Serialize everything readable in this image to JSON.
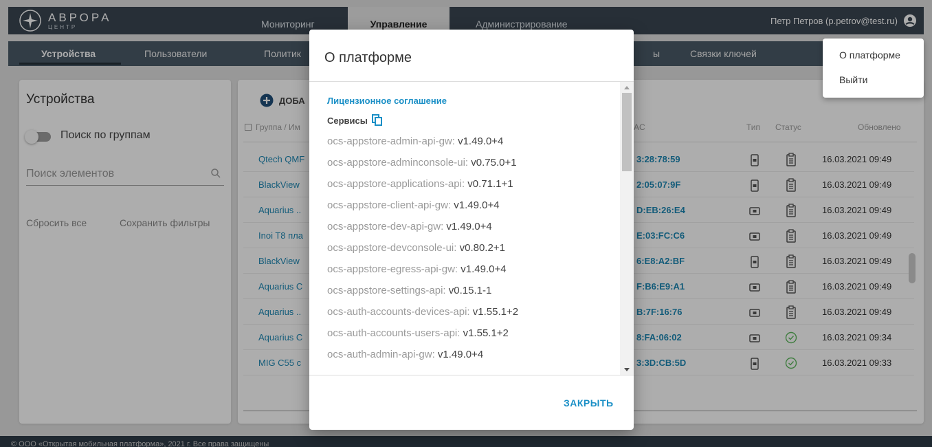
{
  "app": {
    "logo_title": "АВРОРА",
    "logo_subtitle": "ЦЕНТР",
    "nav_tabs": [
      {
        "label": "Мониторинг"
      },
      {
        "label": "Управление"
      },
      {
        "label": "Администрирование"
      }
    ],
    "user": "Петр Петров (p.petrov@test.ru)",
    "user_icon": "account-circle-icon"
  },
  "subnav": {
    "items": [
      {
        "label": "Устройства"
      },
      {
        "label": "Пользователи"
      },
      {
        "label": "Политик"
      },
      {
        "label": "ы"
      },
      {
        "label": "Связки ключей"
      }
    ]
  },
  "filters": {
    "title": "Устройства",
    "group_search_toggle": "Поиск по группам",
    "search_placeholder": "Поиск элементов",
    "reset": "Сбросить все",
    "save": "Сохранить фильтры"
  },
  "devices": {
    "add_label": "ДОБА",
    "columns": {
      "group": "Группа / Им",
      "mac": "AC",
      "type": "Тип",
      "status": "Статус",
      "updated": "Обновлено"
    },
    "rows": [
      {
        "name": "Qtech QMF",
        "mac": "3:28:78:59",
        "type_icon": "phone-icon",
        "status_icon": "clipboard-icon",
        "updated": "16.03.2021 09:49"
      },
      {
        "name": "BlackView",
        "mac": "2:05:07:9F",
        "type_icon": "phone-icon",
        "status_icon": "clipboard-icon",
        "updated": "16.03.2021 09:49"
      },
      {
        "name": "Aquarius ..",
        "mac": "D:EB:26:E4",
        "type_icon": "tablet-icon",
        "status_icon": "clipboard-icon",
        "updated": "16.03.2021 09:49"
      },
      {
        "name": "Inoi T8 пла",
        "mac": "E:03:FC:C6",
        "type_icon": "tablet-icon",
        "status_icon": "clipboard-icon",
        "updated": "16.03.2021 09:49"
      },
      {
        "name": "BlackView",
        "mac": "6:E8:A2:BF",
        "type_icon": "phone-icon",
        "status_icon": "clipboard-icon",
        "updated": "16.03.2021 09:49"
      },
      {
        "name": "Aquarius C",
        "mac": "F:B6:E9:A1",
        "type_icon": "tablet-icon",
        "status_icon": "clipboard-icon",
        "updated": "16.03.2021 09:49"
      },
      {
        "name": "Aquarius ..",
        "mac": "B:7F:16:76",
        "type_icon": "tablet-icon",
        "status_icon": "clipboard-icon",
        "updated": "16.03.2021 09:49"
      },
      {
        "name": "Aquarius C",
        "mac": "8:FA:06:02",
        "type_icon": "tablet-icon",
        "status_icon": "check-circle-icon",
        "updated": "16.03.2021 09:34"
      },
      {
        "name": "MIG C55 с",
        "mac": "3:3D:CB:5D",
        "type_icon": "phone-icon",
        "status_icon": "check-circle-icon",
        "updated": "16.03.2021 09:33"
      }
    ]
  },
  "footer": {
    "text": "© ООО «Открытая мобильная платформа», 2021 г. Все права защищены"
  },
  "user_menu": {
    "items": [
      {
        "label": "О платформе"
      },
      {
        "label": "Выйти"
      }
    ]
  },
  "dialog": {
    "title": "О платформе",
    "license_link": "Лицензионное соглашение",
    "services_title": "Сервисы",
    "services": [
      {
        "name": "ocs-appstore-admin-api-gw:",
        "version": "v1.49.0+4"
      },
      {
        "name": "ocs-appstore-adminconsole-ui:",
        "version": "v0.75.0+1"
      },
      {
        "name": "ocs-appstore-applications-api:",
        "version": "v0.71.1+1"
      },
      {
        "name": "ocs-appstore-client-api-gw:",
        "version": "v1.49.0+4"
      },
      {
        "name": "ocs-appstore-dev-api-gw:",
        "version": "v1.49.0+4"
      },
      {
        "name": "ocs-appstore-devconsole-ui:",
        "version": "v0.80.2+1"
      },
      {
        "name": "ocs-appstore-egress-api-gw:",
        "version": "v1.49.0+4"
      },
      {
        "name": "ocs-appstore-settings-api:",
        "version": "v0.15.1-1"
      },
      {
        "name": "ocs-auth-accounts-devices-api:",
        "version": "v1.55.1+2"
      },
      {
        "name": "ocs-auth-accounts-users-api:",
        "version": "v1.55.1+2"
      },
      {
        "name": "ocs-auth-admin-api-gw:",
        "version": "v1.49.0+4"
      }
    ],
    "close_label": "ЗАКРЫТЬ"
  }
}
